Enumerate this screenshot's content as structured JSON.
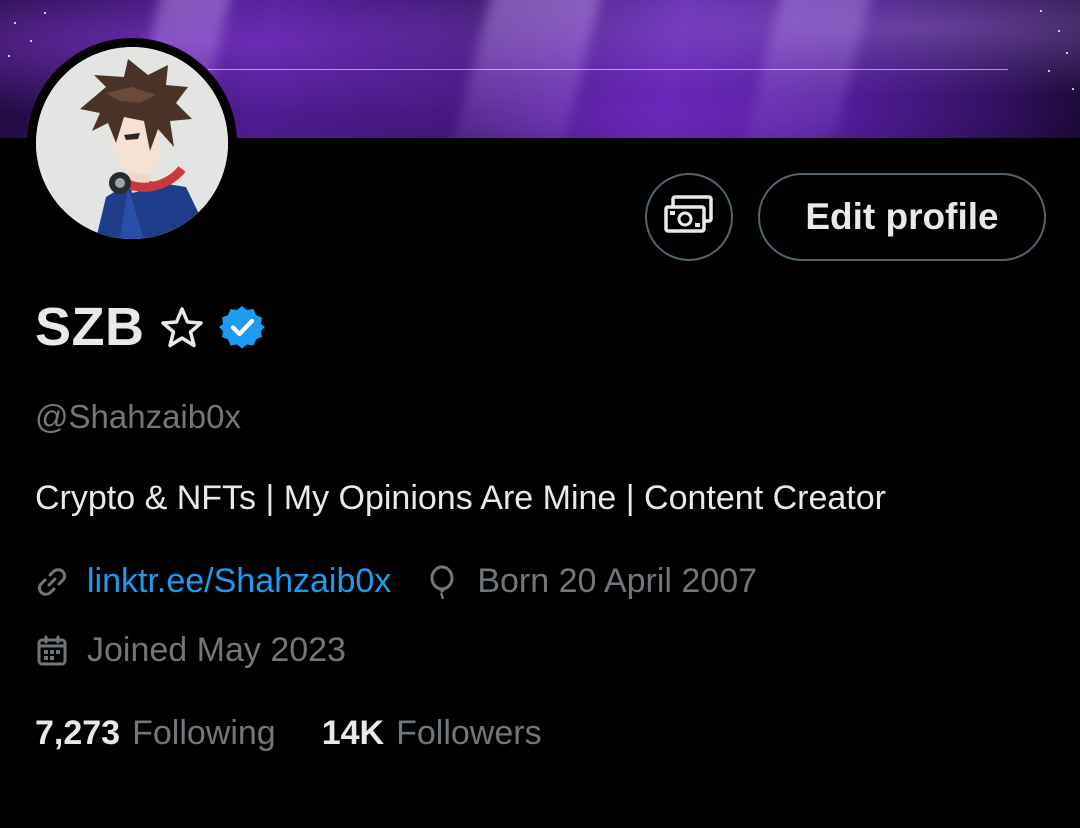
{
  "profile": {
    "display_name": "SZB",
    "handle": "@Shahzaib0x",
    "bio": "Crypto & NFTs | My Opinions Are Mine | Content Creator",
    "website": "linktr.ee/Shahzaib0x",
    "birthday": "Born 20 April 2007",
    "joined": "Joined May 2023"
  },
  "actions": {
    "tip_icon": "money-icon",
    "edit_label": "Edit profile"
  },
  "stats": {
    "following_count": "7,273",
    "following_label": "Following",
    "followers_count": "14K",
    "followers_label": "Followers"
  },
  "icons": {
    "name_badge": "star-outline-icon",
    "verified": "verified-badge-icon",
    "link": "link-icon",
    "birthday": "balloon-icon",
    "calendar": "calendar-icon"
  },
  "colors": {
    "background": "#000000",
    "primary_text": "#e7e9ea",
    "secondary_text": "#71767b",
    "link": "#1d9bf0",
    "verified": "#1d9bf0",
    "button_border": "#536471"
  }
}
